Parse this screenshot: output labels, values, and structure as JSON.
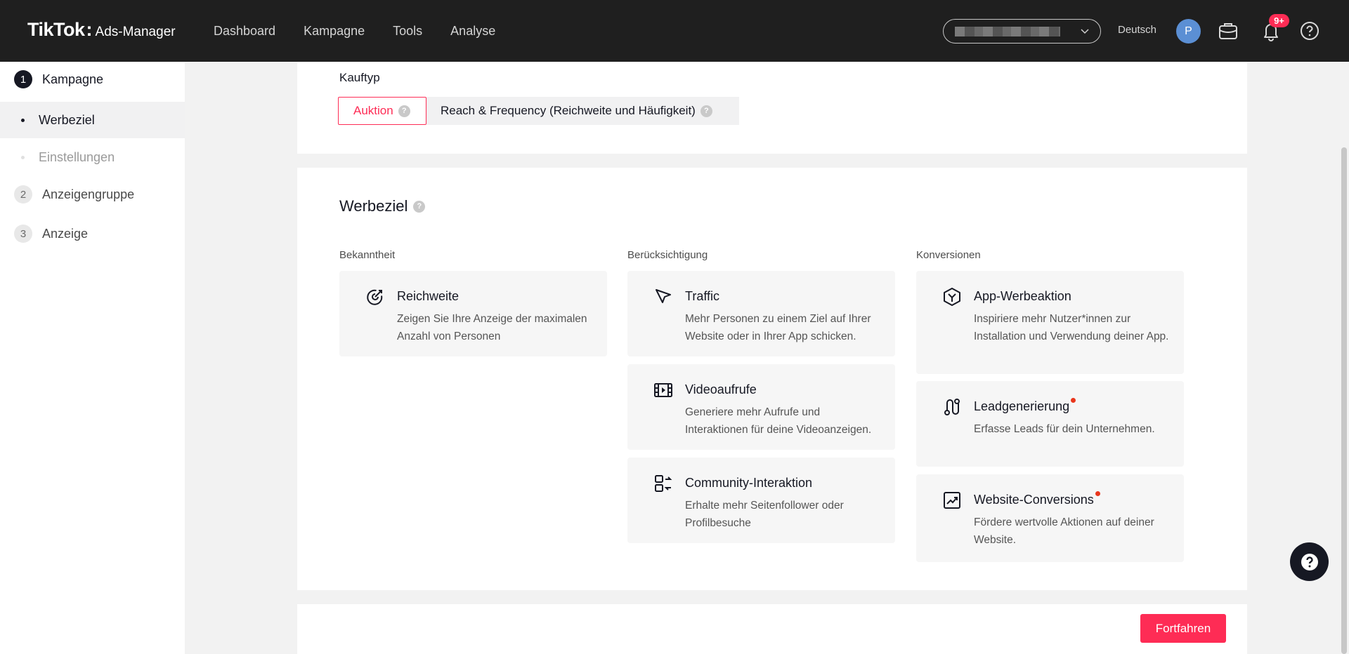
{
  "header": {
    "brand": "TikTok",
    "brand_sep": ":",
    "product": "Ads-Manager",
    "nav": [
      "Dashboard",
      "Kampagne",
      "Tools",
      "Analyse"
    ],
    "language": "Deutsch",
    "avatar_initial": "P",
    "notification_badge": "9+"
  },
  "sidebar": {
    "steps": [
      {
        "num": "1",
        "label": "Kampagne"
      },
      {
        "num": "2",
        "label": "Anzeigengruppe"
      },
      {
        "num": "3",
        "label": "Anzeige"
      }
    ],
    "substeps": [
      {
        "label": "Werbeziel"
      },
      {
        "label": "Einstellungen"
      }
    ]
  },
  "buy_type": {
    "label": "Kauftyp",
    "options": [
      "Auktion",
      "Reach & Frequency (Reichweite und Häufigkeit)"
    ],
    "selected": "Auktion"
  },
  "objective": {
    "title": "Werbeziel",
    "columns": [
      {
        "heading": "Bekanntheit",
        "tiles": [
          {
            "title": "Reichweite",
            "desc": "Zeigen Sie Ihre Anzeige der maximalen Anzahl von Personen",
            "icon": "reach-target-icon"
          }
        ]
      },
      {
        "heading": "Berücksichtigung",
        "tiles": [
          {
            "title": "Traffic",
            "desc": "Mehr Personen zu einem Ziel auf Ihrer Website oder in Ihrer App schicken.",
            "icon": "cursor-arrow-icon"
          },
          {
            "title": "Videoaufrufe",
            "desc": "Generiere mehr Aufrufe und Interaktionen für deine Videoanzeigen.",
            "icon": "film-icon"
          },
          {
            "title": "Community-Interaktion",
            "desc": "Erhalte mehr Seitenfollower oder Profilbesuche",
            "icon": "community-swap-icon"
          }
        ]
      },
      {
        "heading": "Konversionen",
        "tiles": [
          {
            "title": "App-Werbeaktion",
            "desc": "Inspiriere mehr Nutzer*innen zur Installation und Verwendung deiner App.",
            "icon": "app-cube-icon"
          },
          {
            "title": "Leadgenerierung",
            "desc": "Erfasse Leads für dein Unternehmen.",
            "icon": "lead-path-icon",
            "new_dot": true
          },
          {
            "title": "Website-Conversions",
            "desc": "Fördere wertvolle Aktionen auf deiner Website.",
            "icon": "trend-chart-icon",
            "new_dot": true
          }
        ]
      }
    ]
  },
  "footer": {
    "continue_label": "Fortfahren"
  },
  "colors": {
    "accent": "#fe2c55",
    "topbar": "#1f1f1f",
    "new_dot": "#e9361c"
  }
}
